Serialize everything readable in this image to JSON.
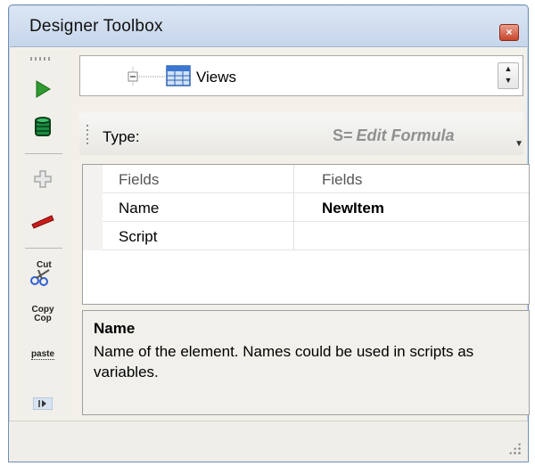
{
  "window": {
    "title": "Designer Toolbox",
    "close_glyph": "×"
  },
  "toolbar": {
    "items": [
      {
        "name": "run",
        "icon": "play-icon",
        "color": "#2f9a2f"
      },
      {
        "name": "database",
        "icon": "database-icon",
        "color": "#1a8c3f"
      },
      {
        "name": "add",
        "icon": "plus-icon",
        "color": "#b0b0b0"
      },
      {
        "name": "remove",
        "icon": "minus-icon",
        "color": "#cc1b1b"
      },
      {
        "name": "cut",
        "icon": "scissors-icon",
        "label": "Cut"
      },
      {
        "name": "copy",
        "icon": "copy-icon",
        "label": "Copy"
      },
      {
        "name": "paste",
        "icon": "paste-icon",
        "label": "paste"
      },
      {
        "name": "expand",
        "icon": "expand-arrow-icon"
      }
    ],
    "copy_sub": "Cop"
  },
  "views": {
    "label": "Views",
    "icon": "table-icon"
  },
  "typebar": {
    "label": "Type:",
    "edit_formula_glyph": "S=",
    "edit_formula_label": "Edit Formula"
  },
  "grid": {
    "columns": [
      "Fields",
      "Fields"
    ],
    "rows": [
      {
        "property": "Name",
        "value": "NewItem"
      },
      {
        "property": "Script",
        "value": ""
      }
    ]
  },
  "description": {
    "title": "Name",
    "text": "Name of the element. Names could be used in scripts as variables."
  }
}
